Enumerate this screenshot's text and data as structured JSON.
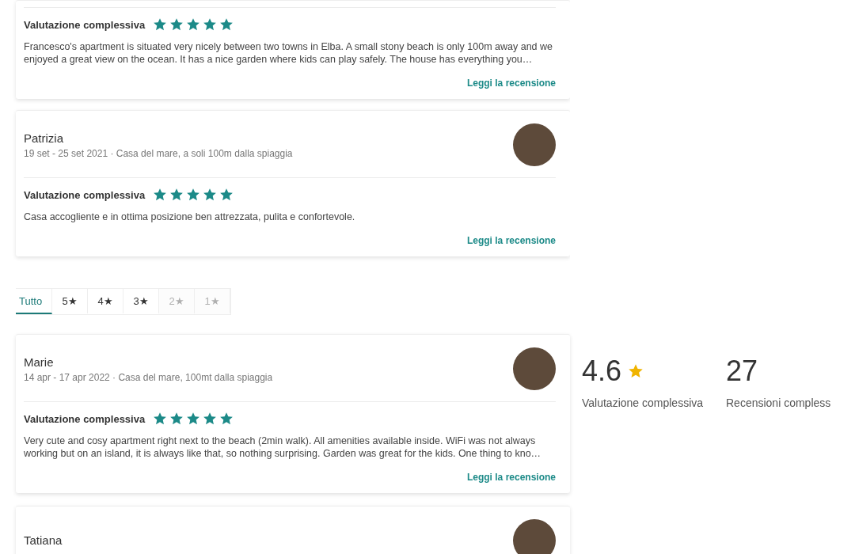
{
  "top_reviews": [
    {
      "rating_label": "Valutazione complessiva",
      "stars": 5,
      "text": "Francesco's apartment is situated very nicely between two towns in Elba. A small stony beach is only 100m away and we enjoyed a great view on the ocean. It has a nice garden where kids can play safely. The house has everything you…",
      "link": "Leggi la recensione"
    },
    {
      "name": "Patrizia",
      "meta": "19 set - 25 set 2021 · Casa del mare, a soli 100m dalla spiaggia",
      "rating_label": "Valutazione complessiva",
      "stars": 5,
      "text": "Casa accogliente e in ottima posizione ben attrezzata, pulita e confortevole.",
      "link": "Leggi la recensione"
    }
  ],
  "filter_tabs": [
    {
      "label": "Tutto",
      "selected": true,
      "disabled": false
    },
    {
      "label": "5★",
      "selected": false,
      "disabled": false
    },
    {
      "label": "4★",
      "selected": false,
      "disabled": false
    },
    {
      "label": "3★",
      "selected": false,
      "disabled": false
    },
    {
      "label": "2★",
      "selected": false,
      "disabled": true
    },
    {
      "label": "1★",
      "selected": false,
      "disabled": true
    }
  ],
  "reviews": [
    {
      "name": "Marie",
      "meta": "14 apr - 17 apr 2022 · Casa del mare, 100mt dalla spiaggia",
      "rating_label": "Valutazione complessiva",
      "stars": 5,
      "text": "Very cute and cosy apartment right next to the beach (2min walk). All amenities available inside. WiFi was not always working but on an island, it is always like that, so nothing surprising. Garden was great for the kids. One thing to kno…",
      "link": "Leggi la recensione"
    },
    {
      "name": "Tatiana"
    }
  ],
  "summary": [
    {
      "kind": "rating",
      "value": "4.6",
      "label": "Valutazione complessiva"
    },
    {
      "kind": "count",
      "value": "27",
      "label": "Recensioni compless"
    }
  ]
}
